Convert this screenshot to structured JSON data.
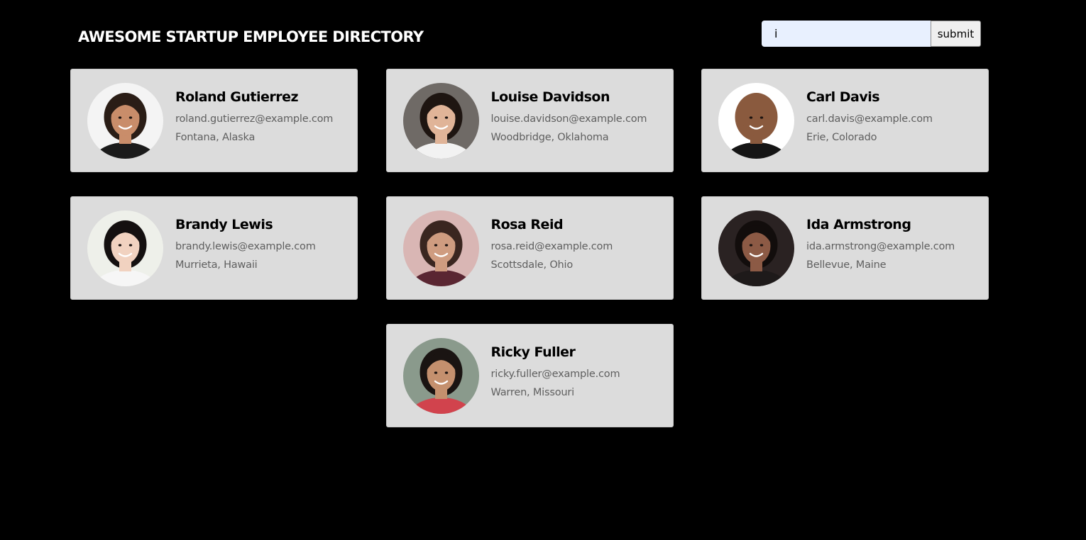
{
  "header": {
    "title": "AWESOME STARTUP EMPLOYEE DIRECTORY"
  },
  "search": {
    "value": "i",
    "submit_label": "submit"
  },
  "employees": [
    {
      "name": "Roland Gutierrez",
      "email": "roland.gutierrez@example.com",
      "location": "Fontana, Alaska",
      "avatar": {
        "bg": "#f4f4f4",
        "skin": "#c98d6a",
        "hair": "#2a1d16",
        "shirt": "#1b1b1b"
      }
    },
    {
      "name": "Louise Davidson",
      "email": "louise.davidson@example.com",
      "location": "Woodbridge, Oklahoma",
      "avatar": {
        "bg": "#6f6a66",
        "skin": "#e0b498",
        "hair": "#1e1511",
        "shirt": "#f2f2f2"
      }
    },
    {
      "name": "Carl Davis",
      "email": "carl.davis@example.com",
      "location": "Erie, Colorado",
      "avatar": {
        "bg": "#ffffff",
        "skin": "#8a5a3e",
        "hair": "#8a5a3e",
        "shirt": "#151515"
      }
    },
    {
      "name": "Brandy Lewis",
      "email": "brandy.lewis@example.com",
      "location": "Murrieta, Hawaii",
      "avatar": {
        "bg": "#eef0ea",
        "skin": "#f1d2c0",
        "hair": "#141010",
        "shirt": "#f6f6f6"
      }
    },
    {
      "name": "Rosa Reid",
      "email": "rosa.reid@example.com",
      "location": "Scottsdale, Ohio",
      "avatar": {
        "bg": "#d9b6b4",
        "skin": "#cf9c80",
        "hair": "#3a2620",
        "shirt": "#5a2632"
      }
    },
    {
      "name": "Ida Armstrong",
      "email": "ida.armstrong@example.com",
      "location": "Bellevue, Maine",
      "avatar": {
        "bg": "#2a2222",
        "skin": "#8c5a45",
        "hair": "#120d0c",
        "shirt": "#1e1a1a"
      }
    },
    {
      "name": "Ricky Fuller",
      "email": "ricky.fuller@example.com",
      "location": "Warren, Missouri",
      "avatar": {
        "bg": "#8a9a8c",
        "skin": "#c4906e",
        "hair": "#1a1412",
        "shirt": "#d1434d"
      }
    }
  ]
}
